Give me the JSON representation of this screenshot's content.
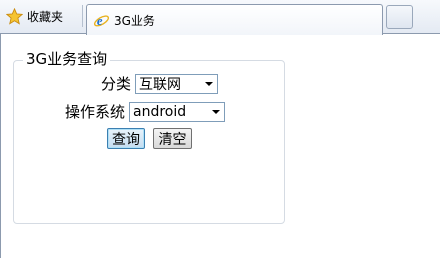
{
  "browser": {
    "favorites_label": "收藏夹",
    "tabs": [
      {
        "label": "3G业务",
        "icon": "ie-icon",
        "active": true
      }
    ]
  },
  "form": {
    "legend": "3G业务查询",
    "category": {
      "label": "分类",
      "selected": "互联网"
    },
    "os": {
      "label": "操作系统",
      "selected": "android"
    },
    "query_button": "查询",
    "clear_button": "清空"
  },
  "colors": {
    "button_query_border": "#3c7fb1",
    "select_border": "#7f9db9",
    "tab_border": "#8c9aae"
  }
}
